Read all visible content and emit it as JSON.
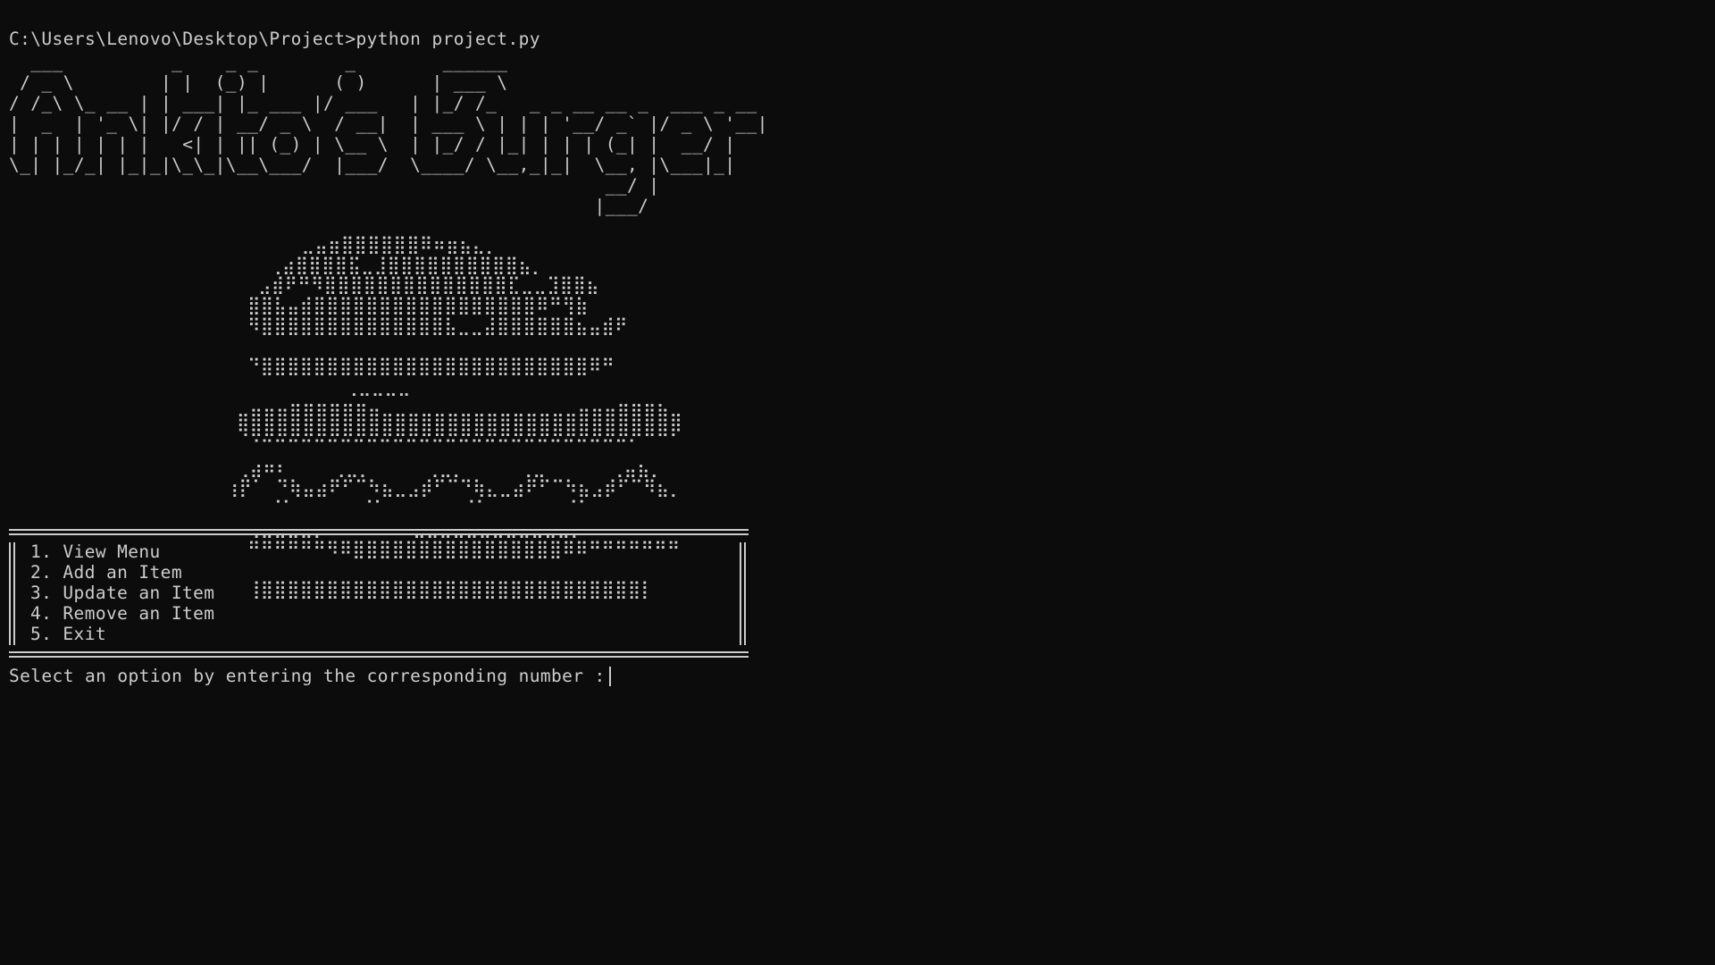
{
  "terminal": {
    "prompt_command": "C:\\Users\\Lenovo\\Desktop\\Project>python project.py",
    "banner": "  ___          _    _ _        _        ______\n / _ \\        | |  (_) |      ( )      | ___ \\\n/ /_\\ \\_ __ | | ___| |_ ___ |/ ___   | |_/ /_   _ _ __ __ _  ___ _ __\n|  _  | '_ \\| |/ / | __/ _ \\  / __|  | ___ \\ | | | '__/ _` |/ _ \\ '__|\n| | | | | | |   <| | || (_) | \\__ \\  | |_/ / |_| | | | (_| |  __/ |\n\\_| |_/_| |_|_|\\_\\_|\\__\\___/  |___/  \\____/ \\__,_|_|  \\__, |\\___|_|\n                                                       __/ |\n                                                      |___/",
    "burger_art": "                           ⣀⣤⣶⣿⣿⣿⣿⣿⣿⠿⠶⣶⣦⣄⡀\n                        ⢀⣴⣿⣿⣿⣿⣯⣀⣸⣿⣿⣿⣿⣿⣿⣿⣿⣿⣿⣦⡀\n                       ⣠⣾⠟⠛⠻⣿⣿⣿⣿⣿⣿⣿⣿⣿⣿⣿⣿⣿⣿⣏⣀⣀⣹⣿⣿⣦\n                      ⣿⣿⣧⣤⣾⣿⣿⣿⣿⣿⣿⣿⣿⣿⣿⣿⣿⣿⣿⣿⣿⣿⠿⠛⢻⣷\n                      ⠻⣿⣿⣿⣿⣿⣿⣿⣿⣿⣿⣿⣿⣿⣿⣧⣀⣀⣼⣿⣿⣿⣿⣿⣿⣦⣤⣾⠟\n\n                      ⠙⣿⣿⣿⣿⣿⣿⣿⣿⣿⣿⣿⣿⣿⣿⣿⣿⣿⣿⣿⣿⣿⣿⣿⣿⣿⠿⠛\n                               ⢀⣀⣀⣀⣀\n                     ⣀⣤⣤⣤⣶⣶⣶⣶⣶⣶⣤⣀⣀⣀⣀⣀⣀⣀⣀⣀⣀⣀⣀⣀⣀⣀⣤⣤⣤⣶⣶⣶⣦⣀\n                     ⢿⣿⣿⣿⣿⣿⣿⣿⣿⣿⣿⣿⣿⣿⣿⣿⣿⣿⣿⣿⣿⣿⣿⣿⣿⣿⣿⣿⣿⣿⣿⣿⣿⡿\n                      ⠈⠉⠉⠉⠉⠉⠉⠉⠉⠉⠉⠉⠉⠉⠉⠉⠉⠉⠉⠉⠉⠉⠉⠉⠉⠉⠉⠉⠉⠁\n                     ⢀⣴⠶⠆    ⢀⣀⡀     ⢀⣀⡀     ⢀⣀      ⢀⣤⣦⡀\n                    ⢰⡟⠁ ⠙⢷⣤⣴⠟⠋⠉⠳⣦⣀⣠⡾⠋⠉⠙⢷⣄⣀⣴⠟⠋⠉⠳⣦⣠⡾⠋⠉⠻⣦⡀\n                        ⠈⠁      ⠈⠁       ⠈⠁       ⠈⠁\n                      ⢀⣀⣀⣀⣀⡀        ⣀⣀⣀⣀⣀⣀⣀⣀⣀⣀⣀⣀⡀\n                      ⠛⠛⠛⠛⠛⠛⠻⠿⣿⣿⣿⣿⣿⣿⣿⣿⣿⣿⣿⣿⣿⣿⣿⣿⠿⠿⠛⠛⠛⠛⠛⠛⠛\n\n                      ⢸⣿⣿⣿⣿⣿⣿⣿⣿⣿⣿⣿⣿⣿⣿⣿⣿⣿⣿⣿⣿⣿⣿⣿⣿⣿⣿⣿⣿⣿⡇",
    "menu_items": [
      "1. View Menu",
      "2. Add an Item",
      "3. Update an Item",
      "4. Remove an Item",
      "5. Exit"
    ],
    "input_prompt": "Select an option by entering the corresponding number : "
  }
}
